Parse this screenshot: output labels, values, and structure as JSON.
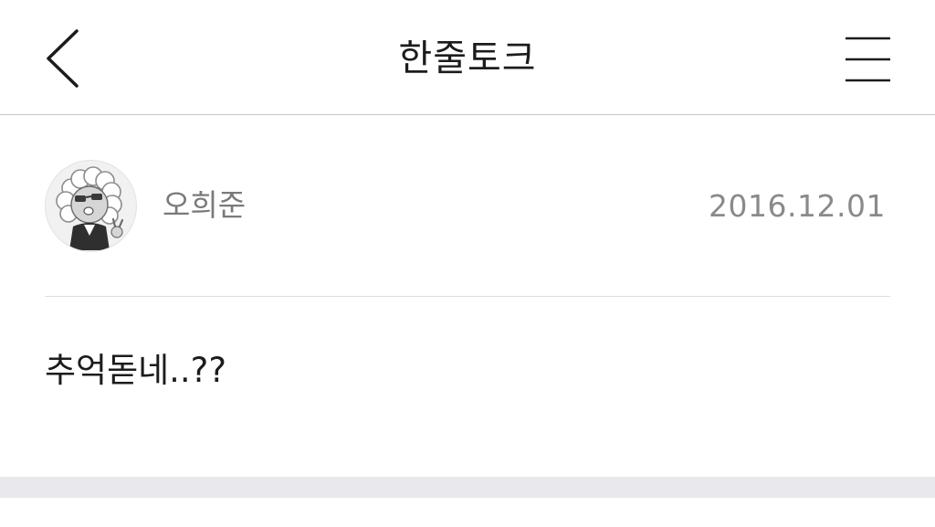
{
  "header": {
    "title": "한줄토크",
    "back_icon": "chevron-left-icon",
    "menu_icon": "hamburger-menu-icon"
  },
  "post": {
    "author": "오희준",
    "date": "2016.12.01",
    "content": "추억돋네..??",
    "avatar_icon": "character-avatar"
  },
  "colors": {
    "header_border": "#c8c8c8",
    "meta_text": "#7a7a7a",
    "footer_band": "#e9e9ed"
  }
}
